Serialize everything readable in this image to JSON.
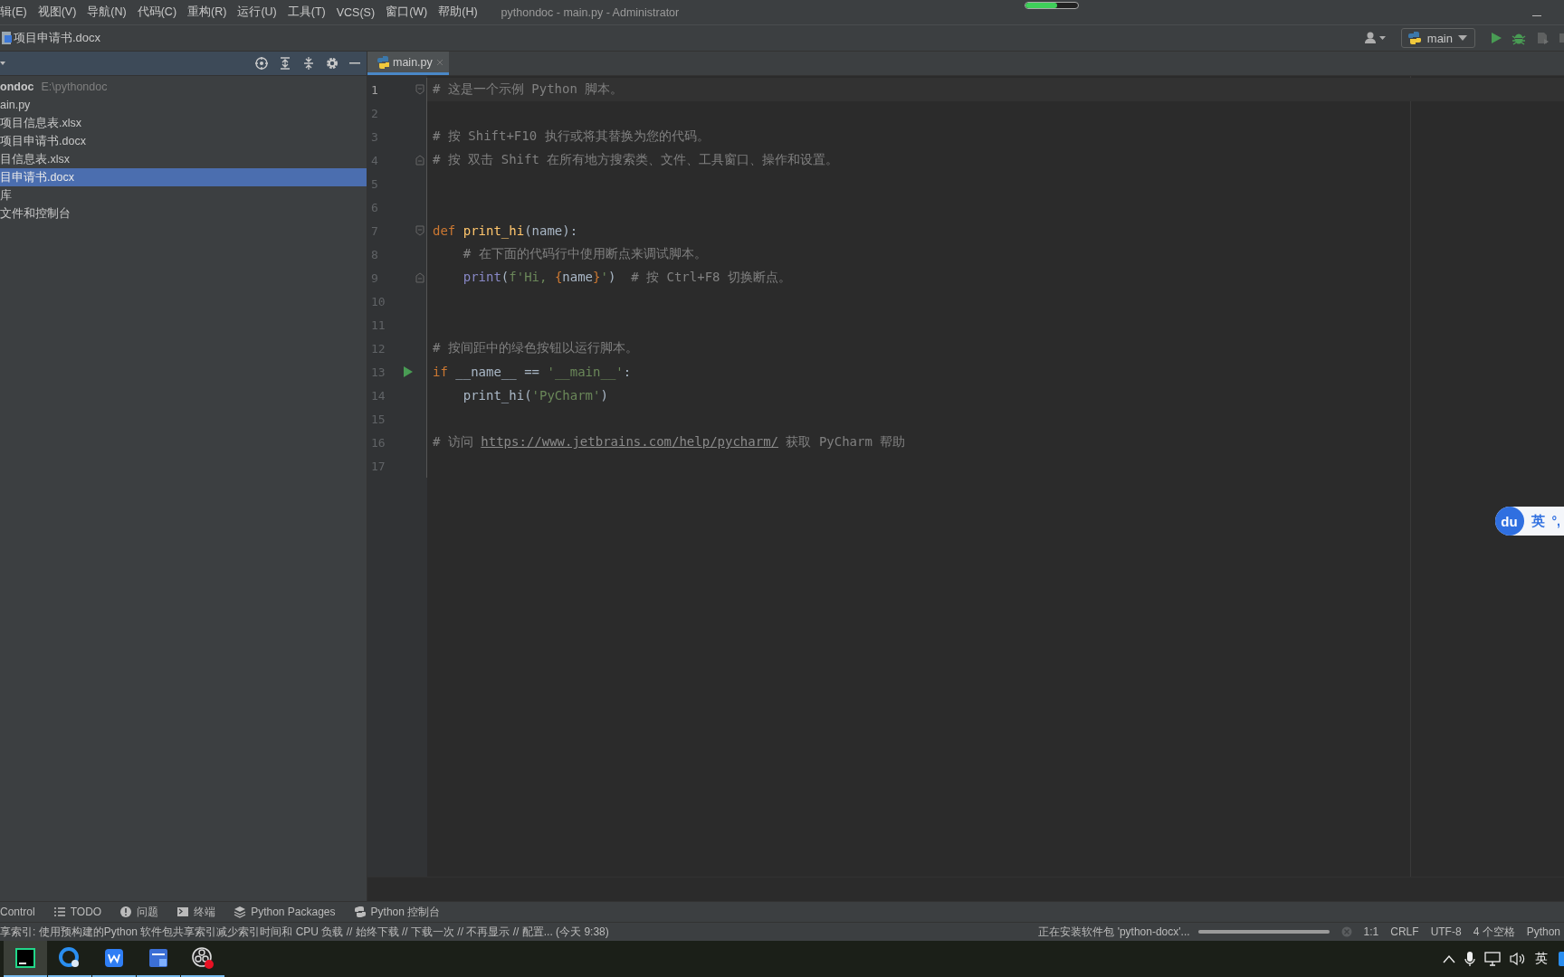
{
  "menu_bar": {
    "items": [
      "辑(E)",
      "视图(V)",
      "导航(N)",
      "代码(C)",
      "重构(R)",
      "运行(U)",
      "工具(T)",
      "VCS(S)",
      "窗口(W)",
      "帮助(H)"
    ],
    "title": "pythondoc - main.py - Administrator",
    "progress": {
      "level": 0.6
    }
  },
  "nav_bar": {
    "breadcrumb": "项目申请书.docx",
    "run_config": "main"
  },
  "project_panel": {
    "root": {
      "name": "ondoc",
      "path": "E:\\pythondoc",
      "selected": false,
      "children": [
        {
          "label": "ain.py",
          "selected": false
        },
        {
          "label": "项目信息表.xlsx",
          "selected": false
        },
        {
          "label": "项目申请书.docx",
          "selected": false
        },
        {
          "label": "目信息表.xlsx",
          "selected": false
        },
        {
          "label": "目申请书.docx",
          "selected": true
        }
      ]
    },
    "extra": [
      {
        "label": "库",
        "selected": false
      },
      {
        "label": "文件和控制台",
        "selected": false
      }
    ]
  },
  "editor": {
    "tabs": [
      {
        "label": "main.py",
        "selected": true
      }
    ],
    "lines": [
      {
        "number": "1",
        "current": true,
        "kind": "fold-start",
        "indented": false,
        "tokens": [
          {
            "kind": "comment",
            "text": "# 这是一个示例 Python 脚本。"
          }
        ]
      },
      {
        "number": "2",
        "current": false,
        "kind": "plain"
      },
      {
        "number": "3",
        "current": false,
        "kind": "plain",
        "indented": false,
        "tokens": [
          {
            "kind": "comment",
            "text": "# 按 Shift+F10 执行或将其替换为您的代码。"
          }
        ]
      },
      {
        "number": "4",
        "current": false,
        "kind": "fold-end",
        "indented": false,
        "tokens": [
          {
            "kind": "comment",
            "text": "# 按 双击 Shift 在所有地方搜索类、文件、工具窗口、操作和设置。"
          }
        ]
      },
      {
        "number": "5",
        "current": false,
        "kind": "plain"
      },
      {
        "number": "6",
        "current": false,
        "kind": "plain"
      },
      {
        "number": "7",
        "current": false,
        "kind": "fold-start",
        "indented": false,
        "tokens": [
          {
            "kind": "keyword",
            "text": "def "
          },
          {
            "kind": "function",
            "text": "print_hi"
          },
          {
            "kind": "plain",
            "text": "(name):"
          }
        ]
      },
      {
        "number": "8",
        "current": false,
        "kind": "plain",
        "indented": true,
        "tokens": [
          {
            "kind": "comment",
            "text": "# 在下面的代码行中使用断点来调试脚本。"
          }
        ]
      },
      {
        "number": "9",
        "current": false,
        "kind": "fold-end",
        "indented": true,
        "tokens": [
          {
            "kind": "builtin",
            "text": "print"
          },
          {
            "kind": "plain",
            "text": "("
          },
          {
            "kind": "string",
            "text": "f'Hi, "
          },
          {
            "kind": "brace",
            "text": "{"
          },
          {
            "kind": "plain",
            "text": "name"
          },
          {
            "kind": "brace",
            "text": "}"
          },
          {
            "kind": "string",
            "text": "'"
          },
          {
            "kind": "plain",
            "text": ")  "
          },
          {
            "kind": "comment",
            "text": "# 按 Ctrl+F8 切换断点。"
          }
        ]
      },
      {
        "number": "10",
        "current": false,
        "kind": "plain"
      },
      {
        "number": "11",
        "current": false,
        "kind": "plain"
      },
      {
        "number": "12",
        "current": false,
        "kind": "plain",
        "indented": false,
        "tokens": [
          {
            "kind": "comment",
            "text": "# 按间距中的绿色按钮以运行脚本。"
          }
        ]
      },
      {
        "number": "13",
        "current": false,
        "kind": "run",
        "indented": false,
        "tokens": [
          {
            "kind": "keyword",
            "text": "if "
          },
          {
            "kind": "plain",
            "text": "__name__ == "
          },
          {
            "kind": "string",
            "text": "'__main__'"
          },
          {
            "kind": "plain",
            "text": ":"
          }
        ]
      },
      {
        "number": "14",
        "current": false,
        "kind": "plain",
        "indented": true,
        "tokens": [
          {
            "kind": "plain",
            "text": "print_hi("
          },
          {
            "kind": "string",
            "text": "'PyCharm'"
          },
          {
            "kind": "plain",
            "text": ")"
          }
        ]
      },
      {
        "number": "15",
        "current": false,
        "kind": "plain"
      },
      {
        "number": "16",
        "current": false,
        "kind": "plain",
        "indented": false,
        "tokens": [
          {
            "kind": "comment",
            "text": "# 访问 "
          },
          {
            "kind": "link",
            "text": "https://www.jetbrains.com/help/pycharm/"
          },
          {
            "kind": "comment",
            "text": " 获取 PyCharm 帮助"
          }
        ]
      },
      {
        "number": "17",
        "current": false,
        "kind": "plain"
      }
    ]
  },
  "tool_tabs": [
    {
      "kind": "plain",
      "label": "Control"
    },
    {
      "kind": "list",
      "label": "TODO"
    },
    {
      "kind": "info",
      "label": "问题"
    },
    {
      "kind": "terminal",
      "label": "终端"
    },
    {
      "kind": "layers",
      "label": "Python Packages"
    },
    {
      "kind": "python",
      "label": "Python 控制台"
    }
  ],
  "status_bar": {
    "message": "享索引: 使用预构建的Python 软件包共享索引减少索引时间和 CPU 负载 // 始终下载 // 下载一次 // 不再显示 // 配置... (今天 9:38)",
    "task": "正在安装软件包 'python-docx'...",
    "task_progress": {
      "level": 1
    },
    "items": [
      "1:1",
      "CRLF",
      "UTF-8",
      "4 个空格",
      "Python"
    ]
  },
  "taskbar": {
    "apps": [
      {
        "kind": "pycharm",
        "selected": true
      },
      {
        "kind": "browser",
        "selected": false
      },
      {
        "kind": "wps",
        "selected": false
      },
      {
        "kind": "work",
        "selected": false
      },
      {
        "kind": "recorder",
        "selected": false
      }
    ],
    "ime": "英"
  },
  "ime_widget": {
    "logo": "du",
    "mode": "英",
    "punct": "°,"
  }
}
